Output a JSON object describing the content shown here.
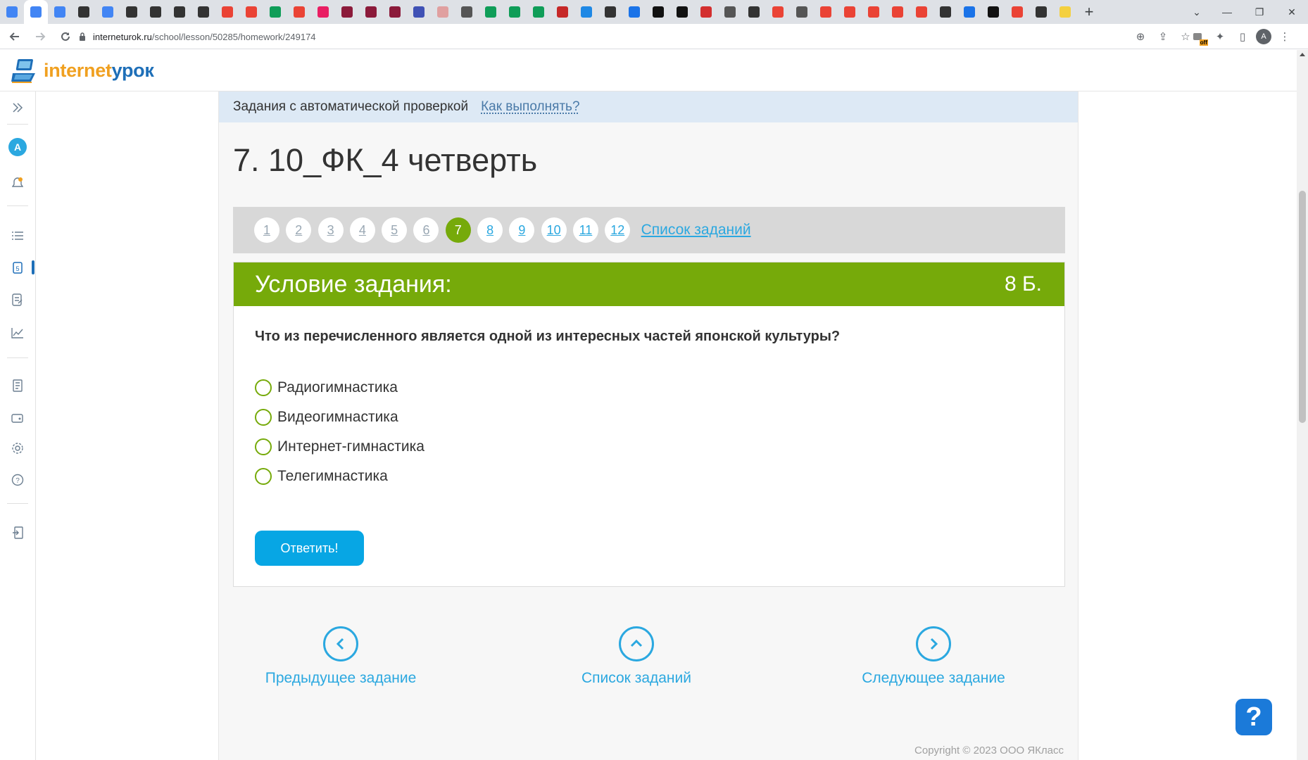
{
  "browser": {
    "tab_favicon_colors": [
      "#4285f4",
      "#4285f4",
      "#4285f4",
      "#333333",
      "#4285f4",
      "#333333",
      "#333333",
      "#333333",
      "#333333",
      "#ea4335",
      "#ea4335",
      "#0f9d58",
      "#ea4335",
      "#e91e63",
      "#8b1a3a",
      "#8b1a3a",
      "#8b1a3a",
      "#3f51b5",
      "#e0a0a0",
      "#555555",
      "#0f9d58",
      "#0f9d58",
      "#0f9d58",
      "#c62828",
      "#1e88e5",
      "#333333",
      "#1a73e8",
      "#111111",
      "#111111",
      "#d32f2f",
      "#555555",
      "#333333",
      "#ea4335",
      "#555555",
      "#ea4335",
      "#ea4335",
      "#ea4335",
      "#ea4335",
      "#ea4335",
      "#333333",
      "#1a73e8",
      "#111111",
      "#ea4335",
      "#333333",
      "#f4d03f"
    ],
    "address_host": "interneturok.ru",
    "address_path": "/school/lesson/50285/homework/249174",
    "profile_initial": "A",
    "ext_badge": "off"
  },
  "site": {
    "logo_part1": "internet",
    "logo_part2": "урок"
  },
  "sidebar": {
    "avatar_initial": "A"
  },
  "content": {
    "mode_text": "Задания с автоматической проверкой",
    "mode_link": "Как выполнять?",
    "lesson_title": "7. 10_ФК_4 четверть",
    "pages": [
      "1",
      "2",
      "3",
      "4",
      "5",
      "6",
      "7",
      "8",
      "9",
      "10",
      "11",
      "12"
    ],
    "current_page": "7",
    "task_list_link": "Список заданий",
    "task_heading": "Условие задания:",
    "points": "8 Б.",
    "question": "Что из перечисленного является одной из интересных частей японской культуры?",
    "options": [
      "Радиогимнастика",
      "Видеогимнастика",
      "Интернет-гимнастика",
      "Телегимнастика"
    ],
    "submit_label": "Ответить!",
    "prev_label": "Предыдущее задание",
    "list_label": "Список заданий",
    "next_label": "Следующее задание",
    "copyright": "Copyright © 2023 ООО ЯКласс"
  },
  "help_label": "?",
  "colors": {
    "accent_green": "#76aa0a",
    "link_blue": "#2ba8e0",
    "button_blue": "#07a6e4",
    "mode_bar_bg": "#dde9f5"
  }
}
